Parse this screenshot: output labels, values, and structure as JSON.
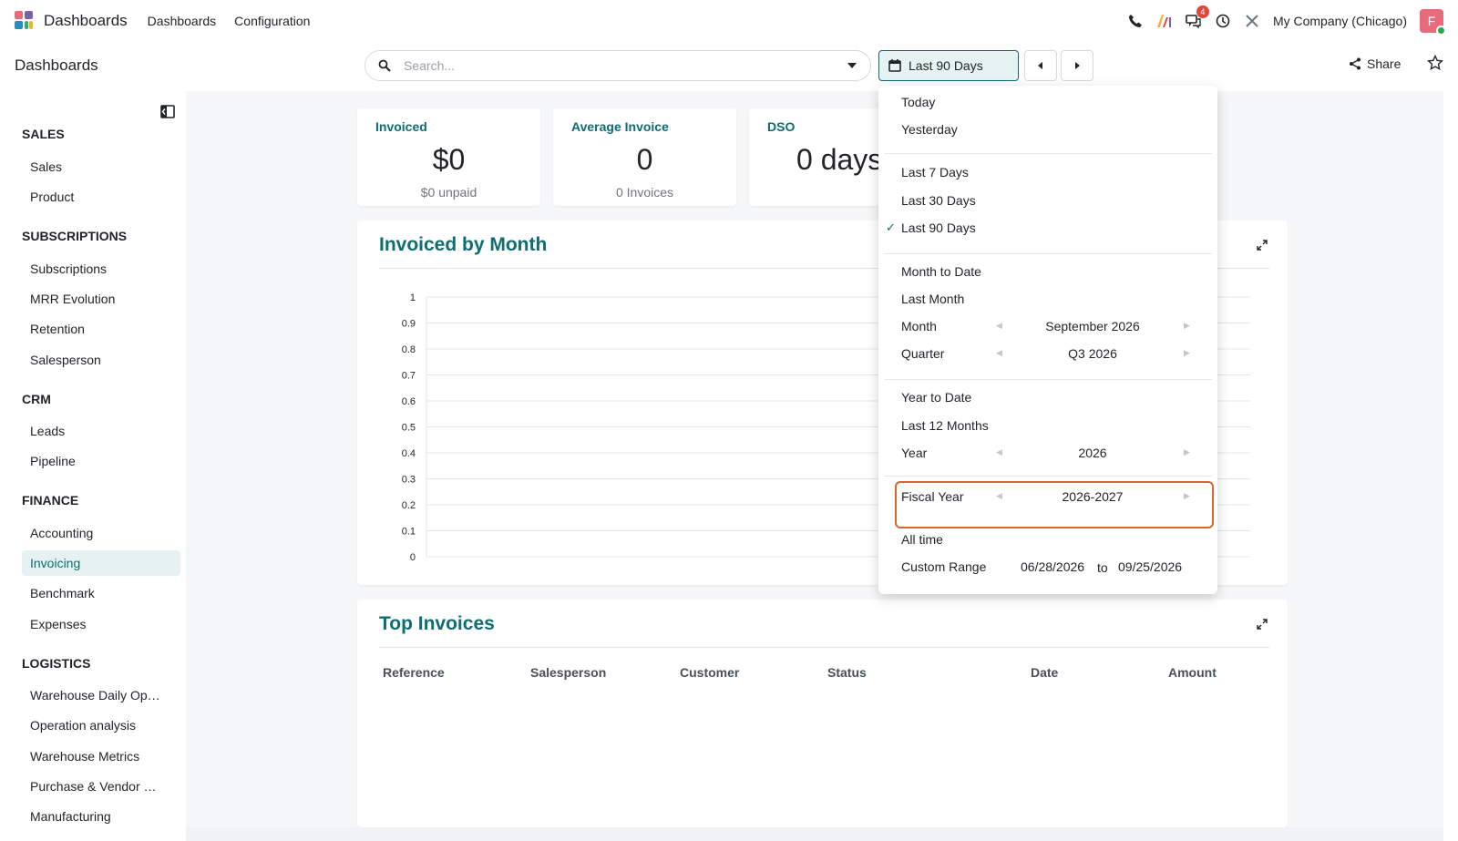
{
  "navbar": {
    "app_title": "Dashboards",
    "menus": [
      "Dashboards",
      "Configuration"
    ],
    "messages_badge": "4",
    "company": "My Company (Chicago)",
    "avatar_letter": "F"
  },
  "control": {
    "breadcrumb": "Dashboards",
    "search_placeholder": "Search...",
    "date_filter_label": "Last 90 Days",
    "share_label": "Share"
  },
  "sidebar": {
    "sections": [
      {
        "title": "SALES",
        "items": [
          "Sales",
          "Product"
        ]
      },
      {
        "title": "SUBSCRIPTIONS",
        "items": [
          "Subscriptions",
          "MRR Evolution",
          "Retention",
          "Salesperson"
        ]
      },
      {
        "title": "CRM",
        "items": [
          "Leads",
          "Pipeline"
        ]
      },
      {
        "title": "FINANCE",
        "items": [
          "Accounting",
          "Invoicing",
          "Benchmark",
          "Expenses"
        ]
      },
      {
        "title": "LOGISTICS",
        "items": [
          "Warehouse Daily Op…",
          "Operation analysis",
          "Warehouse Metrics",
          "Purchase & Vendor …",
          "Manufacturing"
        ]
      }
    ],
    "active_item": "Invoicing"
  },
  "kpis": [
    {
      "title": "Invoiced",
      "value": "$0",
      "sub": "$0 unpaid"
    },
    {
      "title": "Average Invoice",
      "value": "0",
      "sub": "0 Invoices"
    },
    {
      "title": "DSO",
      "value": "0 days",
      "sub": ""
    }
  ],
  "chart_section": {
    "title": "Invoiced by Month"
  },
  "chart_data": {
    "type": "bar",
    "categories": [],
    "values": [],
    "title": "Invoiced by Month",
    "xlabel": "",
    "ylabel": "",
    "ylim": [
      0,
      1
    ],
    "yticks": [
      "1",
      "0.9",
      "0.8",
      "0.7",
      "0.6",
      "0.5",
      "0.4",
      "0.3",
      "0.2",
      "0.1",
      "0"
    ],
    "grid": true
  },
  "top_invoices": {
    "title": "Top Invoices",
    "columns": [
      "Reference",
      "Salesperson",
      "Customer",
      "Status",
      "Date",
      "Amount"
    ]
  },
  "date_dropdown": {
    "simple": [
      "Today",
      "Yesterday",
      "Last 7 Days",
      "Last 30 Days",
      "Last 90 Days",
      "Month to Date",
      "Last Month",
      "Year to Date",
      "Last 12 Months",
      "All time"
    ],
    "selected": "Last 90 Days",
    "month_label": "Month",
    "month_value": "September 2026",
    "quarter_label": "Quarter",
    "quarter_value": "Q3 2026",
    "year_label": "Year",
    "year_value": "2026",
    "fiscal_label": "Fiscal Year",
    "fiscal_value": "2026-2027",
    "custom_label": "Custom Range",
    "custom_from": "06/28/2026",
    "custom_to_word": "to",
    "custom_to": "09/25/2026"
  },
  "colors": {
    "brand": "#0d6d73",
    "highlight": "#d9662e",
    "badge": "#e0463b"
  }
}
